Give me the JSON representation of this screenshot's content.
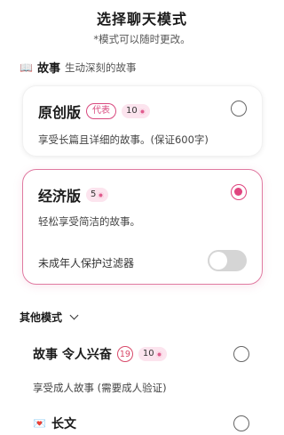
{
  "header": {
    "title": "选择聊天模式",
    "subtitle": "*模式可以随时更改。"
  },
  "section": {
    "icon": "book-icon",
    "name": "故事",
    "description": "生动深刻的故事"
  },
  "cards": [
    {
      "title": "原创版",
      "tag": "代表",
      "count": "10",
      "description": "享受长篇且详细的故事。(保证600字)",
      "selected": false
    },
    {
      "title": "经济版",
      "count": "5",
      "description": "轻松享受简洁的故事。",
      "selected": true,
      "toggle_label": "未成年人保护过滤器",
      "toggle_on": false
    }
  ],
  "other": {
    "label": "其他模式",
    "options": [
      {
        "title": "故事 令人兴奋",
        "age": "19",
        "count": "10",
        "description": "享受成人故事 (需要成人验证)"
      },
      {
        "icon": "love-letter-icon",
        "title": "长文"
      }
    ]
  },
  "colors": {
    "accent": "#e0457f",
    "tag_bg": "#fce4ee"
  }
}
